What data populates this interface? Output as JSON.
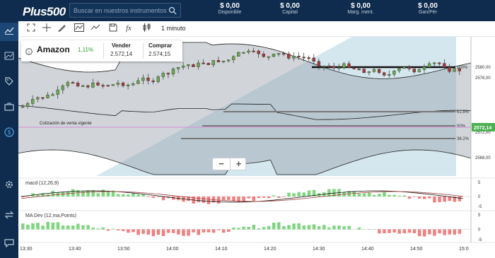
{
  "app": {
    "logo": "Plus500"
  },
  "search": {
    "placeholder": "Buscar en nuestros instrumentos"
  },
  "account": [
    {
      "value": "$ 0,00",
      "label": "Disponible"
    },
    {
      "value": "$ 0,00",
      "label": "Capital"
    },
    {
      "value": "$ 0,00",
      "label": "Marg. ment."
    },
    {
      "value": "$ 0,00",
      "label": "Gan/Pér"
    }
  ],
  "sidebar_icons": [
    "chart-icon",
    "chart-alt-icon",
    "tag-icon",
    "briefcase-icon",
    "dollar-icon",
    "settings-icon",
    "transfer-icon",
    "chat-icon"
  ],
  "toolbar": {
    "icons": [
      "fullscreen-icon",
      "crosshair-icon",
      "pencil-icon",
      "line-chart-icon",
      "trend-icon",
      "save-icon",
      "function-icon",
      "candlestick-icon"
    ],
    "timeframe": "1 minuto"
  },
  "quote": {
    "name": "Amazon",
    "change": "1,11%",
    "sell_label": "Vender",
    "sell_value": "2.572,14",
    "buy_label": "Comprar",
    "buy_value": "2.574,15"
  },
  "colors": {
    "up": "#6aa84f",
    "down": "#a23b3b",
    "brand": "#0f2c4e",
    "price_tag": "#4caf50"
  },
  "chart_data": {
    "type": "candlestick",
    "annotation": "Cotización de venta vigente",
    "current_price": "2572,14",
    "y_ticks": [
      "2580,00",
      "2576,00",
      "2572,00",
      "2568,00"
    ],
    "x_ticks": [
      "13:30",
      "13:40",
      "13:50",
      "14:00",
      "14:10",
      "14:20",
      "14:30",
      "14:40",
      "14:50",
      "15:0"
    ],
    "fib_levels": [
      "100%",
      "61.8%",
      "50%",
      "38.2%"
    ],
    "indicators": [
      {
        "name": "macd (12,26,9)",
        "ticks": [
          "5",
          "0",
          "-5"
        ]
      },
      {
        "name": "MA Dev (12,ma,Points)",
        "ticks": [
          "5",
          "0",
          "-5"
        ]
      }
    ]
  }
}
